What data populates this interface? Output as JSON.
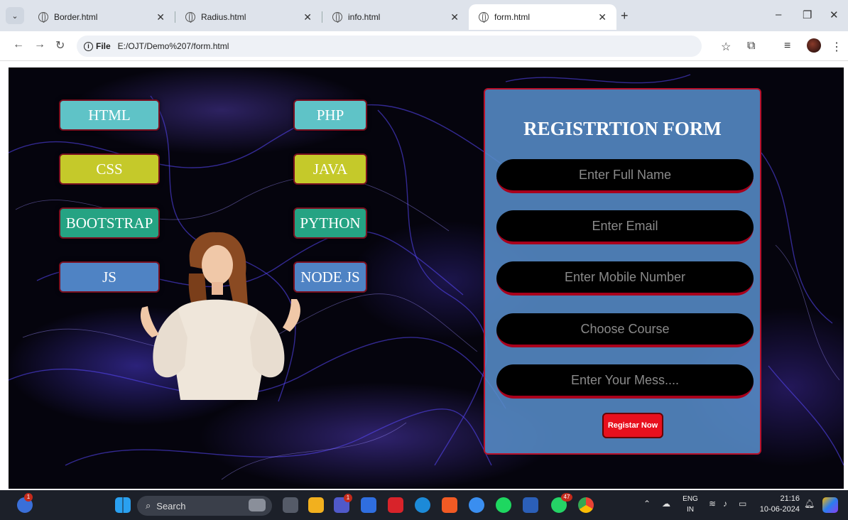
{
  "browser": {
    "tabs": [
      {
        "title": "Border.html"
      },
      {
        "title": "Radius.html"
      },
      {
        "title": "info.html"
      },
      {
        "title": "form.html"
      }
    ],
    "address": {
      "chip": "File",
      "url": "E:/OJT/Demo%207/form.html"
    }
  },
  "page": {
    "skills": [
      {
        "label": "HTML",
        "color": "#5fc3c7"
      },
      {
        "label": "PHP",
        "color": "#5fc3c7"
      },
      {
        "label": "CSS",
        "color": "#c5c92a"
      },
      {
        "label": "JAVA",
        "color": "#c5c92a"
      },
      {
        "label": "BOOTSTRAP",
        "color": "#25a383"
      },
      {
        "label": "PYTHON",
        "color": "#25a383"
      },
      {
        "label": "JS",
        "color": "#4f83c4"
      },
      {
        "label": "NODE JS",
        "color": "#4f83c4"
      }
    ],
    "form": {
      "title": "REGISTRTION FORM",
      "fields": [
        {
          "placeholder": "Enter Full Name"
        },
        {
          "placeholder": "Enter Email"
        },
        {
          "placeholder": "Enter Mobile Number"
        },
        {
          "placeholder": "Choose Course"
        },
        {
          "placeholder": "Enter Your Mess...."
        }
      ],
      "submit_label": "Registar Now"
    }
  },
  "taskbar": {
    "search_label": "Search",
    "weather_badge": "1",
    "teams_badge": "1",
    "whatsapp_badge": "47",
    "language": {
      "line1": "ENG",
      "line2": "IN"
    },
    "clock": {
      "time": "21:16",
      "date": "10-06-2024"
    }
  }
}
